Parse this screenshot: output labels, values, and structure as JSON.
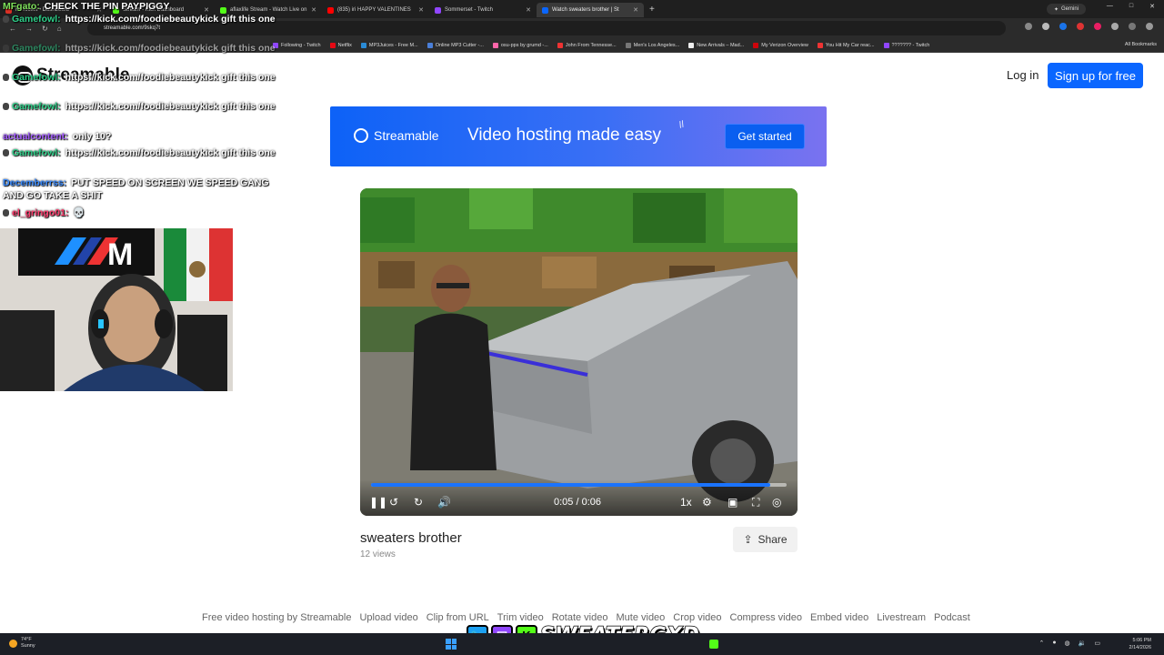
{
  "browser": {
    "tabs": [
      {
        "label": "RLToolkit • Dashboard",
        "color": "#d93025",
        "active": false
      },
      {
        "label": "Stream - Kick Dashboard",
        "color": "#53fc18",
        "active": false
      },
      {
        "label": "aflaxlife Stream - Watch Live on",
        "color": "#53fc18",
        "active": false
      },
      {
        "label": "(835) iri HAPPY VALENTINES",
        "color": "#ff0000",
        "active": false
      },
      {
        "label": "Sommerset - Twitch",
        "color": "#9146ff",
        "active": false
      },
      {
        "label": "Watch sweaters brother | St",
        "color": "#0a66ff",
        "active": true
      }
    ],
    "gemini_label": "Gemini",
    "address": "streamable.com/9skq7t",
    "bookmarks": [
      {
        "label": "Following - Twitch",
        "color": "#9146ff"
      },
      {
        "label": "Netflix",
        "color": "#e50914"
      },
      {
        "label": "MP3Juices - Free M...",
        "color": "#2a8bd6"
      },
      {
        "label": "Online MP3 Cutter -...",
        "color": "#4a7fd8"
      },
      {
        "label": "osu-pps by grumd -...",
        "color": "#ff66aa"
      },
      {
        "label": "John From Tennesse...",
        "color": "#e33"
      },
      {
        "label": "Men's Los Angeles...",
        "color": "#777"
      },
      {
        "label": "New Arrivals – Mad...",
        "color": "#eee"
      },
      {
        "label": "My Verizon Overview",
        "color": "#cd040b"
      },
      {
        "label": "You Hit My Car reac...",
        "color": "#e33"
      },
      {
        "label": "??????? - Twitch",
        "color": "#9146ff"
      }
    ],
    "all_bookmarks": "All Bookmarks"
  },
  "site": {
    "logo": "Streamable",
    "login": "Log in",
    "signup": "Sign up for free"
  },
  "banner": {
    "logo": "Streamable",
    "text": "Video hosting made easy",
    "cta": "Get started"
  },
  "player": {
    "time": "0:05 / 0:06",
    "progress": 0.96,
    "speed": "1x"
  },
  "video": {
    "title": "sweaters brother",
    "views": "12 views",
    "share": "Share"
  },
  "footer": {
    "links": [
      "Free video hosting by Streamable",
      "Upload video",
      "Clip from URL",
      "Trim video",
      "Rotate video",
      "Mute video",
      "Crop video",
      "Compress video",
      "Embed video",
      "Livestream",
      "Podcast"
    ]
  },
  "chat": [
    {
      "user": "MFgato:",
      "text": "CHECK THE PIN PAYPIGGY",
      "color": "#7ee05b",
      "badge": false,
      "ghost": false
    },
    {
      "user": "Gamefowl:",
      "text": "https://kick.com/foodiebeautykick gift this one",
      "color": "#2fd08a",
      "badge": true,
      "ghost": false
    },
    {
      "user": "Gamefowl:",
      "text": "https://kick.com/foodiebeautykick gift this one",
      "color": "#2fd08a",
      "badge": true,
      "ghost": true
    },
    {
      "user": "Gamefowl:",
      "text": "https://kick.com/foodiebeautykick gift this one",
      "color": "#2fd08a",
      "badge": true,
      "ghost": false
    },
    {
      "user": "Gamefowl:",
      "text": "https://kick.com/foodiebeautykick gift this one",
      "color": "#2fd08a",
      "badge": true,
      "ghost": false
    },
    {
      "user": "actualcontent:",
      "text": "only 10?",
      "color": "#a35bff",
      "badge": false,
      "ghost": false
    },
    {
      "user": "Gamefowl:",
      "text": "https://kick.com/foodiebeautykick gift this one",
      "color": "#2fd08a",
      "badge": true,
      "ghost": false
    },
    {
      "user": "Decemberrss:",
      "text": "PUT SPEED ON SCREEN WE SPEED GANG AND GO TAKE A SHIT",
      "color": "#3a8bff",
      "badge": false,
      "ghost": false
    },
    {
      "user": "el_gringo01:",
      "text": "💀",
      "color": "#ff3d6e",
      "badge": true,
      "ghost": false
    }
  ],
  "overlay": {
    "brand": "SWEATERGXD"
  },
  "taskbar": {
    "temp": "74°F",
    "condition": "Sunny",
    "time": "5:06 PM",
    "date": "2/14/2026"
  },
  "colors": {
    "accent": "#0a66ff",
    "kick_green": "#53fc18",
    "twitch_purple": "#9146ff",
    "twitter_blue": "#1da1f2"
  }
}
